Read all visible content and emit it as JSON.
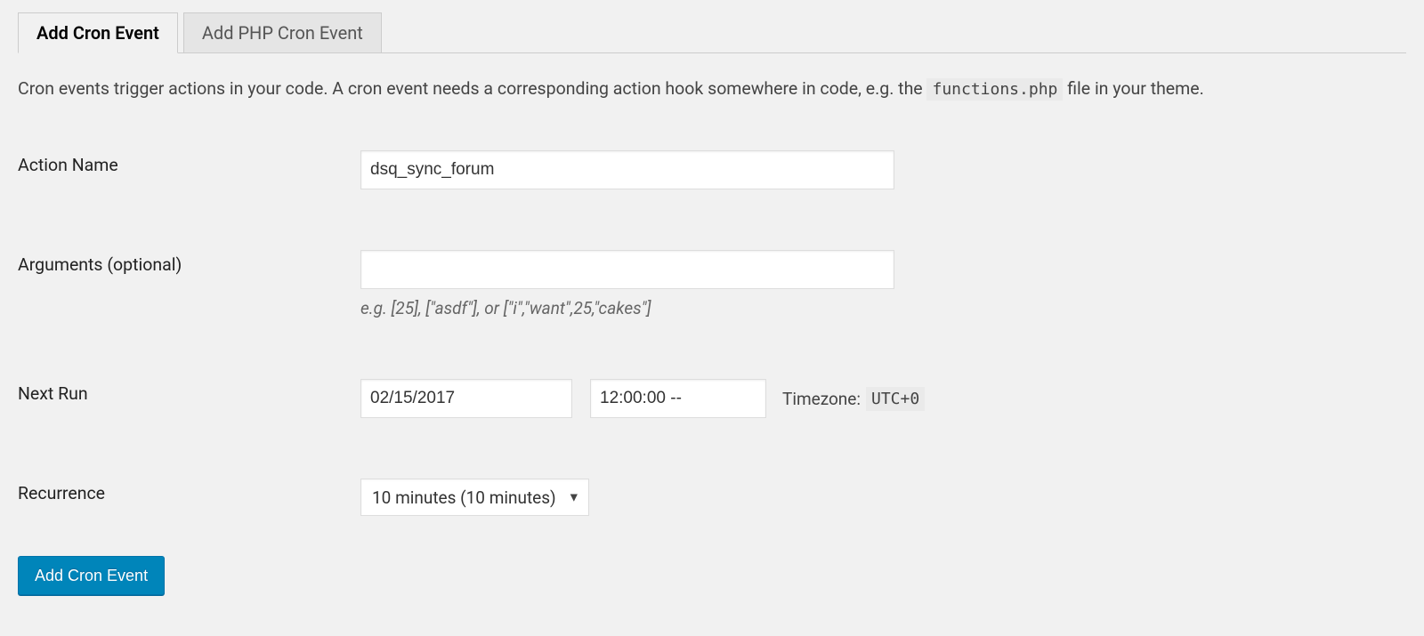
{
  "tabs": {
    "add_cron": "Add Cron Event",
    "add_php_cron": "Add PHP Cron Event"
  },
  "description": {
    "prefix": "Cron events trigger actions in your code. A cron event needs a corresponding action hook somewhere in code, e.g. the ",
    "code": "functions.php",
    "suffix": " file in your theme."
  },
  "form": {
    "action_name": {
      "label": "Action Name",
      "value": "dsq_sync_forum"
    },
    "arguments": {
      "label": "Arguments (optional)",
      "value": "",
      "helper": "e.g. [25], [\"asdf\"], or [\"i\",\"want\",25,\"cakes\"]"
    },
    "next_run": {
      "label": "Next Run",
      "date": "02/15/2017",
      "time": "12:00:00 --",
      "timezone_label": "Timezone:",
      "timezone_value": "UTC+0"
    },
    "recurrence": {
      "label": "Recurrence",
      "value": "10 minutes (10 minutes)"
    },
    "submit": "Add Cron Event"
  }
}
